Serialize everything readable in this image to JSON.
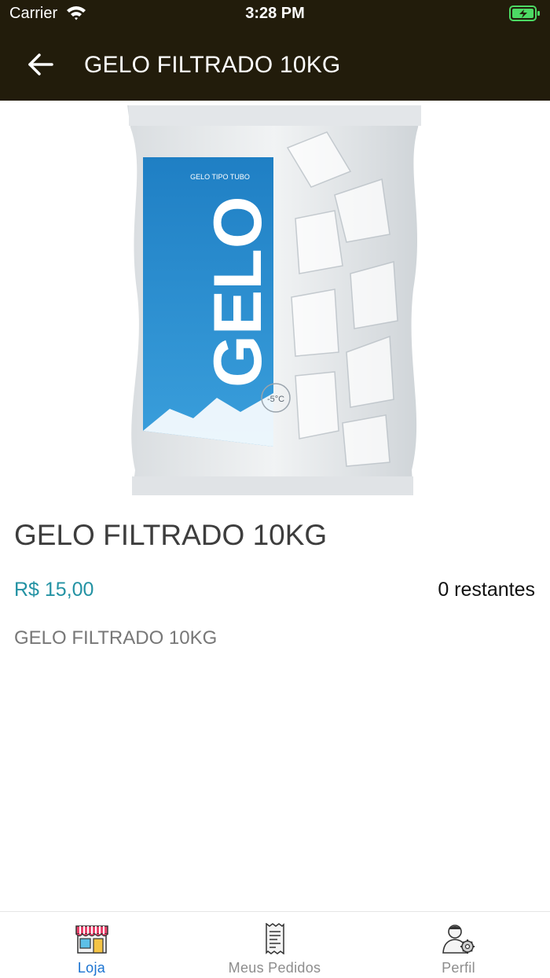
{
  "status_bar": {
    "carrier": "Carrier",
    "time": "3:28 PM"
  },
  "nav": {
    "title": "GELO FILTRADO 10KG",
    "back_icon": "arrow-left-icon"
  },
  "product": {
    "image_brand": "GELO",
    "image_small_text": "GELO TIPO TUBO",
    "image_temp": "-5°C",
    "name": "GELO FILTRADO 10KG",
    "price": "R$ 15,00",
    "stock": "0 restantes",
    "description": "GELO FILTRADO 10KG"
  },
  "tabbar": {
    "tabs": [
      {
        "label": "Loja",
        "icon": "store-icon",
        "active": true
      },
      {
        "label": "Meus Pedidos",
        "icon": "receipt-icon",
        "active": false
      },
      {
        "label": "Perfil",
        "icon": "user-settings-icon",
        "active": false
      }
    ]
  },
  "colors": {
    "header_bg": "#221c0b",
    "price": "#2392a3",
    "tab_active": "#1a73d1",
    "tab_inactive": "#8d8d8d",
    "battery": "#4cd964"
  }
}
